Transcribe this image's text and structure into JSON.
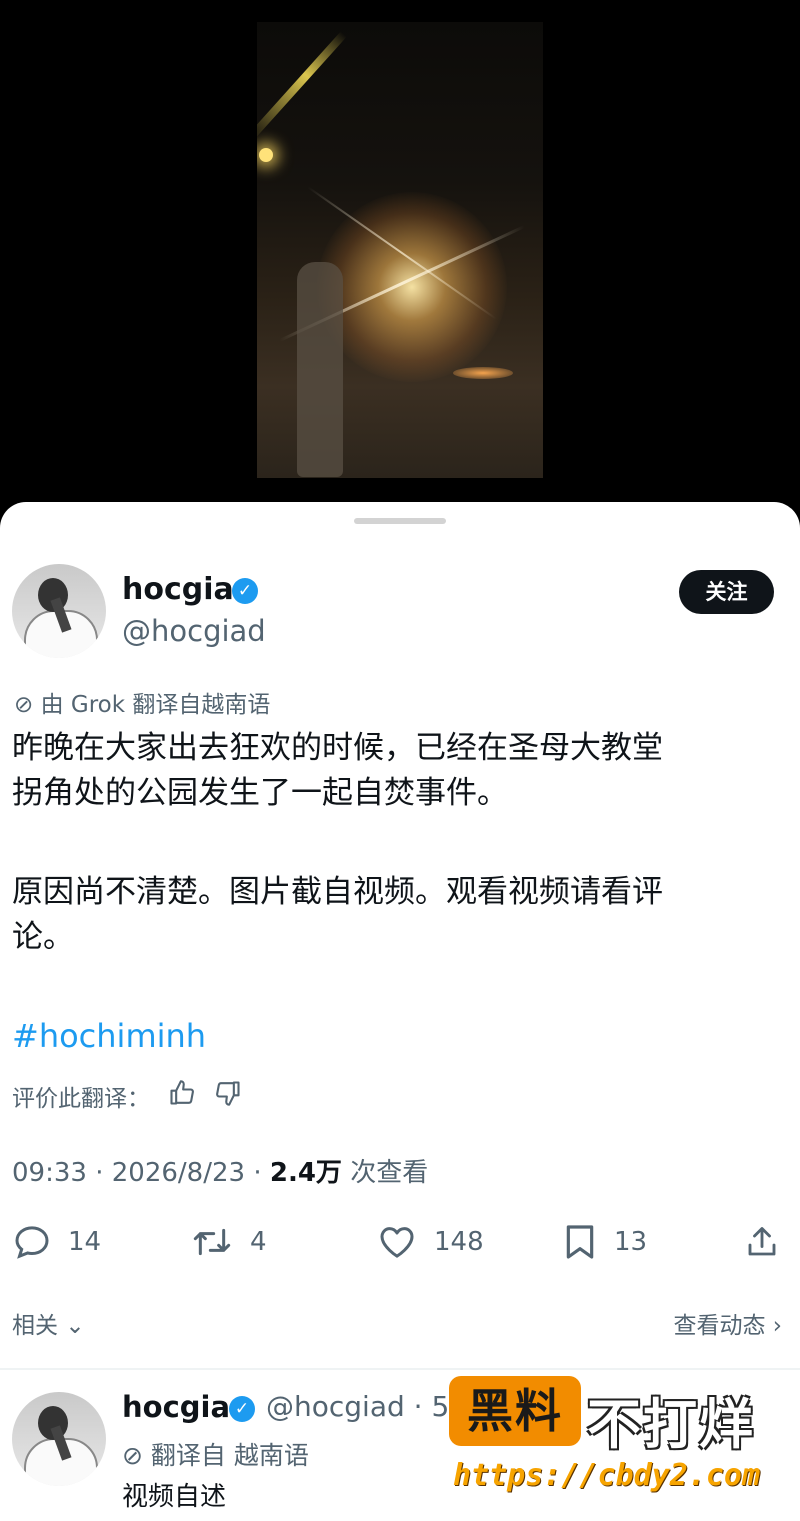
{
  "post": {
    "author_name": "hocgia",
    "author_handle": "@hocgiad",
    "follow_label": "关注",
    "translation_note": "由 Grok 翻译自越南语",
    "body_line_1": "昨晚在大家出去狂欢的时候，已经在圣母大教堂",
    "body_line_2": "拐角处的公园发生了一起自焚事件。",
    "body_line_3": "原因尚不清楚。图片截自视频。观看视频请看评",
    "body_line_4": "论。",
    "hashtag": "#hochiminh",
    "rate_label": "评价此翻译：",
    "time": "09:33",
    "date": "2026/8/23",
    "views_count": "2.4万",
    "views_label": "次查看"
  },
  "actions": {
    "replies": "14",
    "reposts": "4",
    "likes": "148",
    "bookmarks": "13"
  },
  "related": {
    "left_label": "相关",
    "right_label": "查看动态"
  },
  "reply": {
    "author_name": "hocgia",
    "author_handle": "@hocgiad",
    "time_partial": "· 5",
    "translation_note": "翻译自 越南语",
    "text": "视频自述"
  },
  "watermark": {
    "box_text": "黑料",
    "title": "不打烊",
    "url": "https://cbdy2.com"
  },
  "icons": {
    "verified": "verified-badge-icon",
    "translate": "grok-icon",
    "thumb_up": "thumb-up-icon",
    "thumb_down": "thumb-down-icon",
    "reply": "reply-icon",
    "repost": "repost-icon",
    "like": "heart-icon",
    "bookmark": "bookmark-icon",
    "share": "share-icon",
    "chevron_down": "chevron-down-icon",
    "chevron_right": "chevron-right-icon"
  },
  "colors": {
    "accent": "#1d9bf0",
    "text": "#0f1419",
    "muted": "#536471",
    "watermark_orange": "#f28c00"
  }
}
